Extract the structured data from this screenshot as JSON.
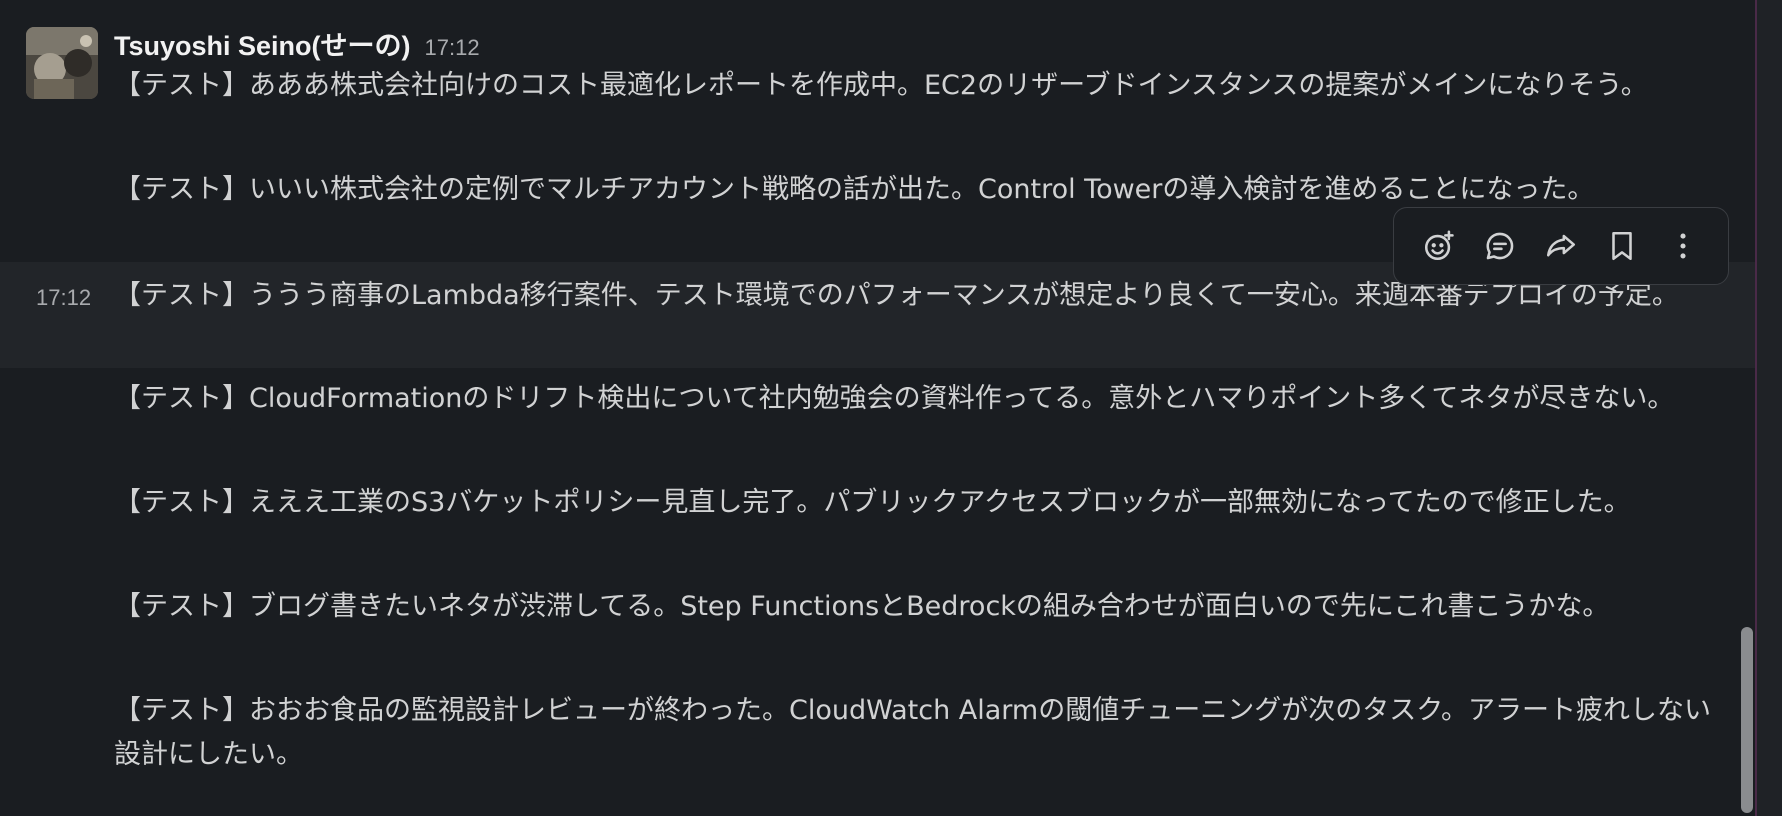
{
  "sender": {
    "name": "Tsuyoshi Seino(せーの)",
    "time": "17:12"
  },
  "hover_time": "17:12",
  "messages": [
    "【テスト】あああ株式会社向けのコスト最適化レポートを作成中。EC2のリザーブドインスタンスの提案がメインになりそう。",
    "【テスト】いいい株式会社の定例でマルチアカウント戦略の話が出た。Control Towerの導入検討を進めることになった。",
    "【テスト】ううう商事のLambda移行案件、テスト環境でのパフォーマンスが想定より良くて一安心。来週本番デプロイの予定。",
    "【テスト】CloudFormationのドリフト検出について社内勉強会の資料作ってる。意外とハマりポイント多くてネタが尽きない。",
    "【テスト】えええ工業のS3バケットポリシー見直し完了。パブリックアクセスブロックが一部無効になってたので修正した。",
    "【テスト】ブログ書きたいネタが渋滞してる。Step FunctionsとBedrockの組み合わせが面白いので先にこれ書こうかな。",
    "【テスト】おおお食品の監視設計レビューが終わった。CloudWatch Alarmの閾値チューニングが次のタスク。アラート疲れしない設計にしたい。"
  ],
  "toolbar": {
    "icons": [
      "add-reaction-icon",
      "reply-in-thread-icon",
      "forward-icon",
      "save-bookmark-icon",
      "more-actions-icon"
    ]
  },
  "colors": {
    "background": "#1a1d21",
    "hover_row": "#222529",
    "text": "#d1d2d3",
    "muted": "#a9abae"
  }
}
